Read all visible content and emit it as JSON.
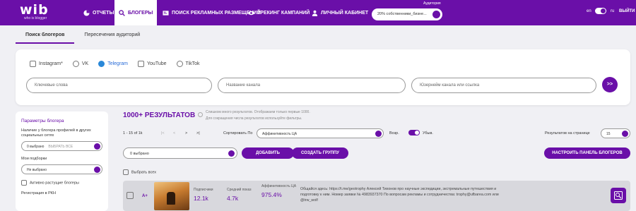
{
  "header": {
    "logo": "wib",
    "logo_sub": "who is blogger",
    "nav": [
      {
        "label": "ОТЧЕТЫ",
        "icon": "pie-chart-icon"
      },
      {
        "label": "БЛОГЕРЫ",
        "icon": "search-icon"
      },
      {
        "label": "ПОИСК РЕКЛАМНЫХ РАЗМЕЩЕНИЙ",
        "icon": "ad-icon"
      },
      {
        "label": "ТРЕКИНГ КАМПАНИЙ",
        "icon": "eye-icon"
      },
      {
        "label": "ЛИЧНЫЙ КАБИНЕТ",
        "icon": "user-icon"
      }
    ],
    "audience_label": "Аудитория",
    "audience_value": "20% собственники_бизне...",
    "lang_en": "en",
    "lang_ru": "ru",
    "exit": "ВЫЙТИ"
  },
  "tabs": [
    "Поиск блогеров",
    "Пересечения аудиторий"
  ],
  "networks": [
    {
      "label": "Instagram*",
      "icon": "instagram-icon"
    },
    {
      "label": "VK",
      "icon": "vk-icon"
    },
    {
      "label": "Telegram",
      "icon": "telegram-icon"
    },
    {
      "label": "YouTube",
      "icon": "youtube-icon"
    },
    {
      "label": "TikTok",
      "icon": "tiktok-icon"
    }
  ],
  "search": {
    "keywords_placeholder": "Ключевые слова",
    "channel_name_placeholder": "Название канала",
    "username_placeholder": "Юзернейм канала или ссылка",
    "go": ">>"
  },
  "sidebar": {
    "title": "Параметры блогера",
    "presence_label": "Наличие у блогера профилей в других социальных сетях",
    "presence_value": "0 выбрано",
    "presence_placeholder": "ВЫБРАТЬ ВСЕ",
    "my_selections_label": "Мои подборки",
    "my_selections_value": "Не выбрано",
    "growing_label": "Активно растущие блогеры",
    "registration_label": "Регистрация в РКН"
  },
  "results": {
    "title": "1000+ РЕЗУЛЬТАТОВ",
    "info_line1": "Слишком много результатов. Отображаем только первые 1000.",
    "info_line2": "Для сокращения числа результатов используйте фильтры.",
    "range": "1 - 15 of 1k",
    "sort_label": "Сортировать По",
    "sort_value": "Аффинитивность ЦА",
    "asc_label": "Возр.",
    "desc_label": "Убыв.",
    "per_page_label": "Результатов на странице",
    "per_page_value": "15",
    "selected_value": "0 выбрано",
    "add_button": "ДОБАВИТЬ",
    "create_group_button": "СОЗДАТЬ ГРУППУ",
    "configure_button": "НАСТРОИТЬ ПАНЕЛЬ БЛОГЕРОВ",
    "select_all": "Выбрать всех"
  },
  "row": {
    "aplus": "A+",
    "subscribers_label": "Подписчики",
    "subscribers_value": "12.1k",
    "avg_views_label": "Средний показ",
    "avg_views_value": "4.7k",
    "affinity_label": "Аффинитивность ЦА",
    "affinity_value": "975.4%",
    "description": "Общайся здесь: https://t.me/geotrophy Алексей Тихонов про научные экспедиции, экстремальные путешествия и подготовку к ним. Номер заявки № 4983937370 По вопросам рекламы и сотрудничества: trophy@ufbarea.com или @trw_wolf"
  },
  "colors": {
    "brand": "#6a0fa8",
    "background": "#f0f0f4"
  }
}
